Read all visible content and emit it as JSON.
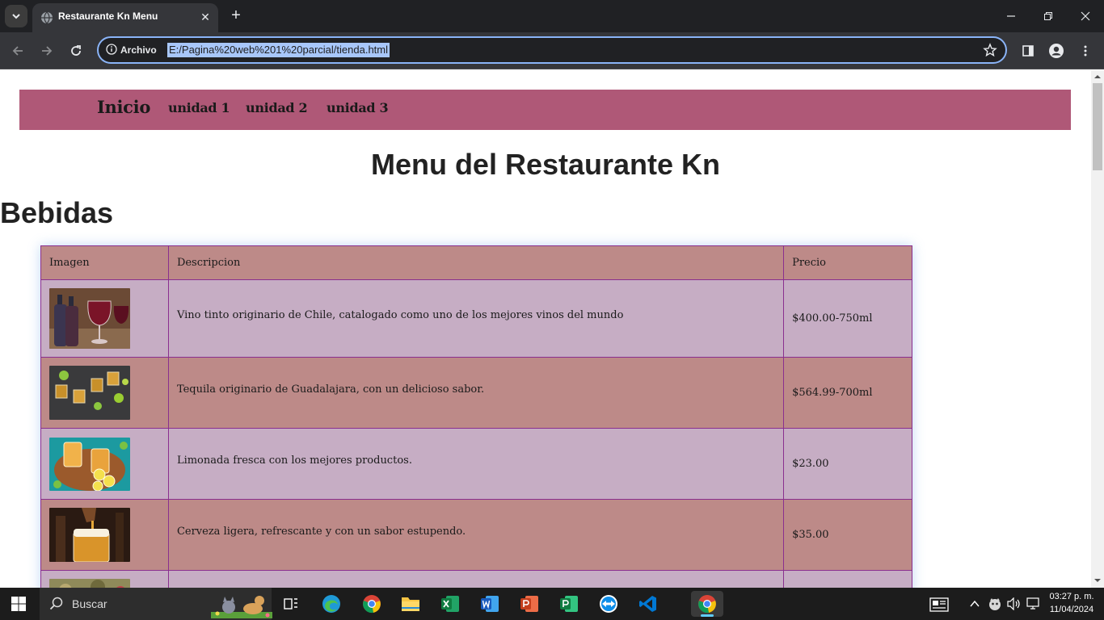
{
  "browser": {
    "tab_title": "Restaurante Kn Menu",
    "security_label": "Archivo",
    "url": "E:/Pagina%20web%201%20parcial/tienda.html"
  },
  "site": {
    "nav": {
      "inicio": "Inicio",
      "unidad1": "unidad 1",
      "unidad2": "unidad 2",
      "unidad3": "unidad 3"
    },
    "title": "Menu del Restaurante Kn",
    "section": "Bebidas",
    "table": {
      "headers": [
        "Imagen",
        "Descripcion",
        "Precio"
      ],
      "rows": [
        {
          "image": "red-wine-photo",
          "description": "Vino tinto originario de Chile, catalogado como uno de los mejores vinos del mundo",
          "price": "$400.00-750ml"
        },
        {
          "image": "tequila-shots-photo",
          "description": "Tequila originario de Guadalajara, con un delicioso sabor.",
          "price": "$564.99-700ml"
        },
        {
          "image": "lemonade-photo",
          "description": "Limonada fresca con los mejores productos.",
          "price": "$23.00"
        },
        {
          "image": "beer-photo",
          "description": "Cerveza ligera, refrescante y con un sabor estupendo.",
          "price": "$35.00"
        },
        {
          "image": "partial-next-photo",
          "description": "",
          "price": ""
        }
      ]
    },
    "colors": {
      "nav_bg": "#af5877",
      "row_light": "#c6adc4",
      "row_dark": "#bd8a88",
      "border": "#8a2f8f"
    }
  },
  "taskbar": {
    "search_placeholder": "Buscar",
    "time": "03:27 p. m.",
    "date": "11/04/2024",
    "apps": [
      "task-view",
      "edge",
      "chrome",
      "file-explorer",
      "excel",
      "word",
      "powerpoint",
      "project",
      "teamviewer",
      "vscode",
      "chrome-active"
    ]
  }
}
